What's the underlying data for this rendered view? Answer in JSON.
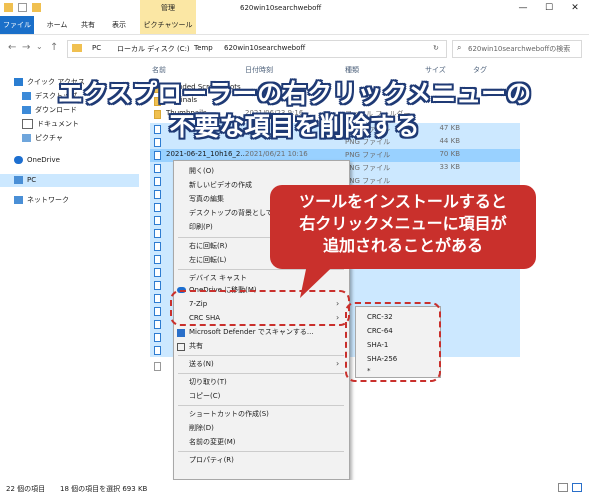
{
  "titlebar": {
    "manage_tab": "管理",
    "window_title": "620win10searchweboff",
    "min": "—",
    "max": "☐",
    "close": "✕"
  },
  "ribbon": {
    "tabs": [
      "ファイル",
      "ホーム",
      "共有",
      "表示",
      "ピクチャツール"
    ]
  },
  "address": {
    "path": [
      "PC",
      "ローカル ディスク (C:)",
      "Temp",
      "620win10searchweboff"
    ],
    "search_placeholder": "620win10searchweboffの検索"
  },
  "nav": {
    "quick_access": "クイック アクセス",
    "items": [
      "デスクトップ",
      "ダウンロード",
      "ドキュメント",
      "ピクチャ"
    ],
    "onedrive": "OneDrive",
    "pc": "PC",
    "network": "ネットワーク"
  },
  "columns": {
    "name": "名前",
    "date": "日付時刻",
    "type": "種類",
    "size": "サイズ",
    "tag": "タグ"
  },
  "files": [
    {
      "name": "Branded Screenshots",
      "date": "",
      "type": "",
      "size": ""
    },
    {
      "name": "Originals",
      "date": "",
      "type": "",
      "size": ""
    },
    {
      "name": "Thumbnails",
      "date": "2021/06/23 9:16",
      "type": "ファイル フォルダー",
      "size": ""
    },
    {
      "name": "",
      "date": "",
      "type": "PNG ファイル",
      "size": "47 KB"
    },
    {
      "name": "",
      "date": "",
      "type": "PNG ファイル",
      "size": "44 KB"
    },
    {
      "name": "2021-06-21_10h16_2...",
      "date": "2021/06/21 10:16",
      "type": "PNG ファイル",
      "size": "70 KB"
    },
    {
      "name": "",
      "date": "",
      "type": "PNG ファイル",
      "size": "33 KB"
    },
    {
      "name": "",
      "date": "",
      "type": "PNG ファイル",
      "size": ""
    }
  ],
  "context_menu": {
    "items": [
      "開く(O)",
      "新しいビデオの作成",
      "写真の編集",
      "デスクトップの背景として設定",
      "印刷(P)",
      "右に回転(R)",
      "左に回転(L)",
      "デバイス キャスト",
      "OneDrive に移動(M)",
      "7-Zip",
      "CRC SHA",
      "Microsoft Defender でスキャンする...",
      "共有",
      "送る(N)",
      "切り取り(T)",
      "コピー(C)",
      "ショートカットの作成(S)",
      "削除(D)",
      "名前の変更(M)",
      "プロパティ(R)"
    ]
  },
  "submenu": {
    "items": [
      "CRC-32",
      "CRC-64",
      "SHA-1",
      "SHA-256",
      "*"
    ]
  },
  "status": {
    "count": "22 個の項目",
    "selected": "18 個の項目を選択  693 KB"
  },
  "overlay": {
    "headline1": "エクスプローラーの右クリックメニューの",
    "headline2": "不要な項目を削除する",
    "callout1": "ツールをインストールすると",
    "callout2": "右クリックメニューに項目が",
    "callout3": "追加されることがある"
  }
}
